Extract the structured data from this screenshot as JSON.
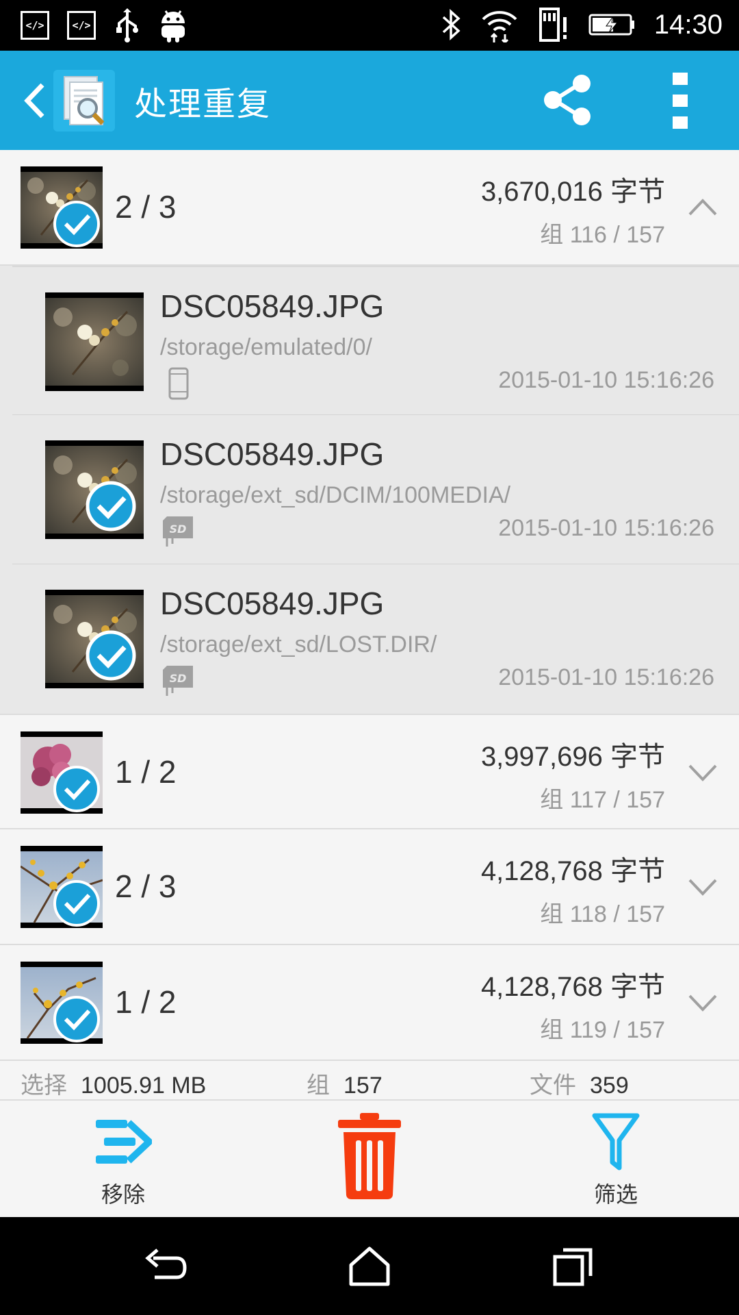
{
  "status_bar": {
    "time": "14:30",
    "code_icon_text": "</>",
    "left_icons": [
      "code-icon",
      "code-icon",
      "usb-icon",
      "android-icon"
    ],
    "right_icons": [
      "bluetooth-icon",
      "wifi-icon",
      "sd-card-alert-icon",
      "battery-charging-icon"
    ]
  },
  "app_bar": {
    "title": "处理重复",
    "icons": [
      "back-icon",
      "app-search-file-icon",
      "share-icon",
      "more-vert-icon"
    ]
  },
  "groups": [
    {
      "count": "2 / 3",
      "size": "3,670,016 字节",
      "index": "组 116 / 157",
      "expanded": true,
      "checked": true,
      "files": [
        {
          "name": "DSC05849.JPG",
          "path": "/storage/emulated/0/",
          "storage_icon": "phone-icon",
          "date": "2015-01-10 15:16:26",
          "checked": false
        },
        {
          "name": "DSC05849.JPG",
          "path": "/storage/ext_sd/DCIM/100MEDIA/",
          "storage_icon": "sd-card-icon",
          "date": "2015-01-10 15:16:26",
          "checked": true
        },
        {
          "name": "DSC05849.JPG",
          "path": "/storage/ext_sd/LOST.DIR/",
          "storage_icon": "sd-card-icon",
          "date": "2015-01-10 15:16:26",
          "checked": true
        }
      ]
    },
    {
      "count": "1 / 2",
      "size": "3,997,696 字节",
      "index": "组 117 / 157",
      "expanded": false,
      "checked": true
    },
    {
      "count": "2 / 3",
      "size": "4,128,768 字节",
      "index": "组 118 / 157",
      "expanded": false,
      "checked": true
    },
    {
      "count": "1 / 2",
      "size": "4,128,768 字节",
      "index": "组 119 / 157",
      "expanded": false,
      "checked": true
    }
  ],
  "summary": {
    "selected_label": "选择",
    "selected_value": "1005.91 MB",
    "groups_label": "组",
    "groups_value": "157",
    "files_label": "文件",
    "files_value": "359"
  },
  "toolbar": {
    "remove_label": "移除",
    "filter_label": "筛选",
    "icons": [
      "move-out-icon",
      "trash-icon",
      "filter-icon"
    ]
  },
  "nav_bar": {
    "icons": [
      "nav-back-icon",
      "nav-home-icon",
      "nav-recents-icon"
    ]
  },
  "colors": {
    "accent": "#1ba8dc",
    "delete": "#f53c0f",
    "toolbar_icon": "#1fb5ee",
    "check": "#1ba0d8"
  }
}
